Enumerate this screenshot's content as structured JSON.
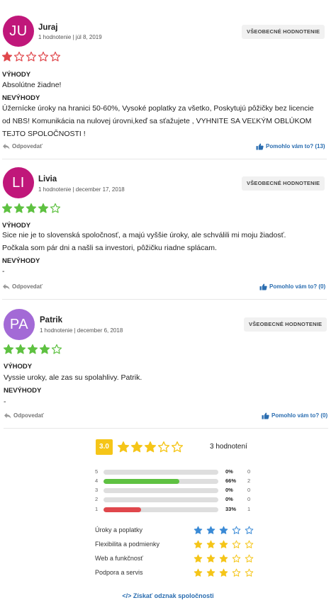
{
  "reviews": [
    {
      "initials": "JU",
      "avatar_color": "#c0177a",
      "name": "Juraj",
      "meta": "1 hodnotenie | júl 8, 2019",
      "category": "VŠEOBECNÉ HODNOTENIE",
      "rating": 1,
      "star_color": "#e0474c",
      "pros_label": "VÝHODY",
      "pros_text": "Absolútne žiadne!",
      "cons_label": "NEVÝHODY",
      "cons_text": "Úžernícke úroky na hranici 50-60%, Vysoké poplatky za všetko, Poskytujú pôžičky bez licencie od NBS! Komunikácia na nulovej úrovni,keď sa sťažujete , VYHNITE SA VEĽKÝM OBLÚKOM TEJTO SPOLOČNOSTI !",
      "reply": "Odpovedať",
      "helpful": "Pomohlo vám to? (13)"
    },
    {
      "initials": "LI",
      "avatar_color": "#c0177a",
      "name": "Livia",
      "meta": "1 hodnotenie | december 17, 2018",
      "category": "VŠEOBECNÉ HODNOTENIE",
      "rating": 4,
      "star_color": "#5ec141",
      "pros_label": "VÝHODY",
      "pros_text": "Sice nie je to slovenská spoločnosť, a majú vyššie úroky, ale schválili mi moju žiadosť. Počkala som pár dni a našli sa investori, pôžičku riadne splácam.",
      "cons_label": "NEVÝHODY",
      "cons_text": "-",
      "reply": "Odpovedať",
      "helpful": "Pomohlo vám to? (0)"
    },
    {
      "initials": "PA",
      "avatar_color": "#a36ad6",
      "name": "Patrik",
      "meta": "1 hodnotenie | december 6, 2018",
      "category": "VŠEOBECNÉ HODNOTENIE",
      "rating": 4,
      "star_color": "#5ec141",
      "pros_label": "VÝHODY",
      "pros_text": "Vyssie uroky, ale zas su spolahlivy. Patrik.",
      "cons_label": "NEVÝHODY",
      "cons_text": "-",
      "reply": "Odpovedať",
      "helpful": "Pomohlo vám to? (0)"
    }
  ],
  "summary": {
    "score": "3.0",
    "rating": 3,
    "count_label": "3 hodnotení",
    "distribution": [
      {
        "stars": "5",
        "pct": "0%",
        "count": "0",
        "fraction": 0,
        "color": "#dedede"
      },
      {
        "stars": "4",
        "pct": "66%",
        "count": "2",
        "fraction": 0.66,
        "color": "#5ec141"
      },
      {
        "stars": "3",
        "pct": "0%",
        "count": "0",
        "fraction": 0,
        "color": "#dedede"
      },
      {
        "stars": "2",
        "pct": "0%",
        "count": "0",
        "fraction": 0,
        "color": "#dedede"
      },
      {
        "stars": "1",
        "pct": "33%",
        "count": "1",
        "fraction": 0.33,
        "color": "#e0474c"
      }
    ],
    "criteria": [
      {
        "label": "Úroky a poplatky",
        "rating": 3,
        "color": "#3a8ad6"
      },
      {
        "label": "Flexibilita a podmienky",
        "rating": 3,
        "color": "#f5c518"
      },
      {
        "label": "Web a funkčnosť",
        "rating": 3,
        "color": "#f5c518"
      },
      {
        "label": "Podpora a servis",
        "rating": 3,
        "color": "#f5c518"
      }
    ],
    "badge_link": "</> Získať odznak spoločnosti"
  }
}
